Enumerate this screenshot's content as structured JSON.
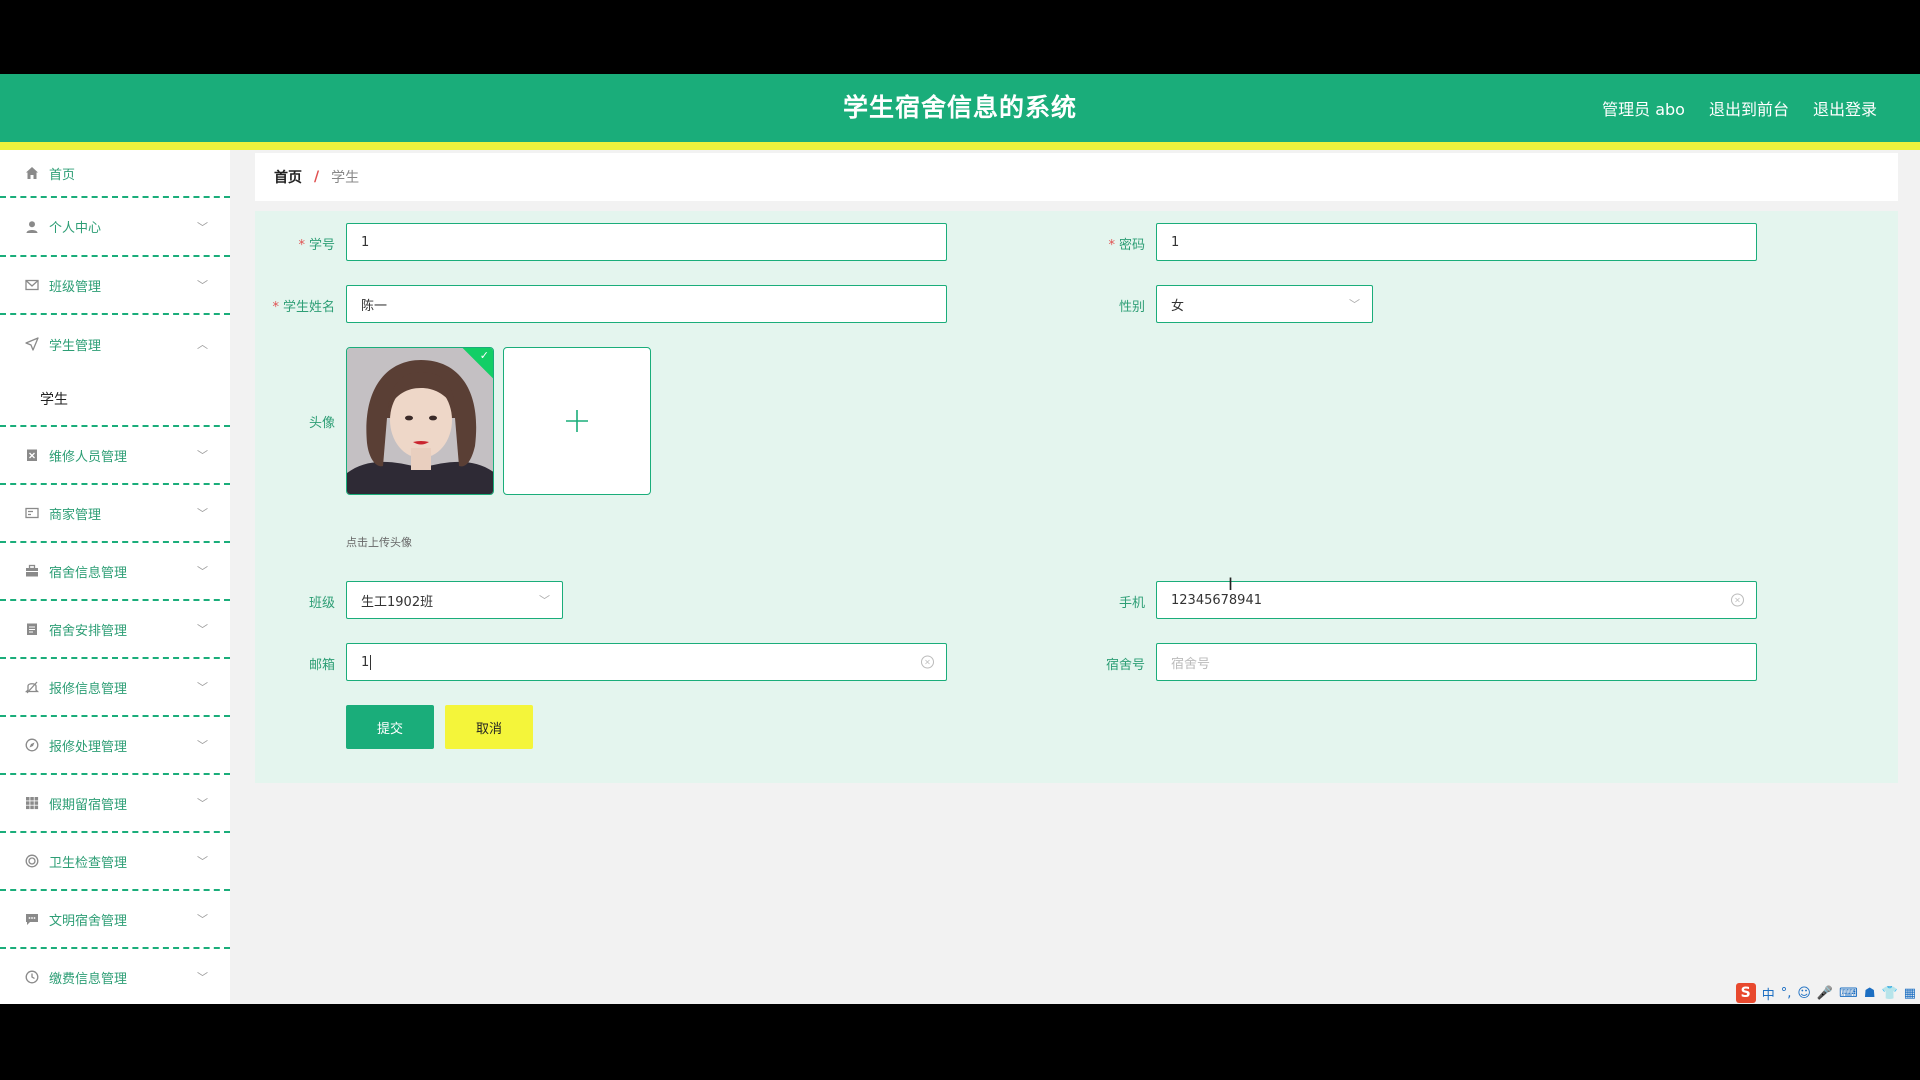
{
  "header": {
    "title": "学生宿舍信息的系统",
    "admin_label": "管理员 abo",
    "back_to_front": "退出到前台",
    "logout": "退出登录"
  },
  "sidebar": {
    "items": [
      {
        "label": "首页",
        "icon": "home-icon"
      },
      {
        "label": "个人中心",
        "icon": "user-icon"
      },
      {
        "label": "班级管理",
        "icon": "mail-icon"
      },
      {
        "label": "学生管理",
        "icon": "send-icon",
        "expanded": true,
        "children": [
          {
            "label": "学生"
          }
        ]
      },
      {
        "label": "维修人员管理",
        "icon": "clipboard-icon"
      },
      {
        "label": "商家管理",
        "icon": "card-icon"
      },
      {
        "label": "宿舍信息管理",
        "icon": "briefcase-icon"
      },
      {
        "label": "宿舍安排管理",
        "icon": "document-icon"
      },
      {
        "label": "报修信息管理",
        "icon": "bell-icon"
      },
      {
        "label": "报修处理管理",
        "icon": "compass-icon"
      },
      {
        "label": "假期留宿管理",
        "icon": "grid-icon"
      },
      {
        "label": "卫生检查管理",
        "icon": "target-icon"
      },
      {
        "label": "文明宿舍管理",
        "icon": "chat-icon"
      },
      {
        "label": "缴费信息管理",
        "icon": "clock-icon"
      }
    ]
  },
  "breadcrumb": {
    "home": "首页",
    "separator": "/",
    "current": "学生"
  },
  "form": {
    "student_id": {
      "label": "学号",
      "value": "1",
      "required": true
    },
    "password": {
      "label": "密码",
      "value": "1",
      "required": true
    },
    "student_name": {
      "label": "学生姓名",
      "value": "陈一",
      "required": true
    },
    "gender": {
      "label": "性别",
      "value": "女"
    },
    "avatar": {
      "label": "头像",
      "hint": "点击上传头像"
    },
    "class": {
      "label": "班级",
      "value": "生工1902班"
    },
    "phone": {
      "label": "手机",
      "value": "12345678941"
    },
    "email": {
      "label": "邮箱",
      "value": "1"
    },
    "dorm_number": {
      "label": "宿舍号",
      "value": "",
      "placeholder": "宿舍号"
    },
    "submit_label": "提交",
    "cancel_label": "取消"
  },
  "tray": {
    "ime_label": "中"
  },
  "colors": {
    "brand": "#1aad7a",
    "accent_yellow": "#f4f53a",
    "required": "#e05050"
  }
}
